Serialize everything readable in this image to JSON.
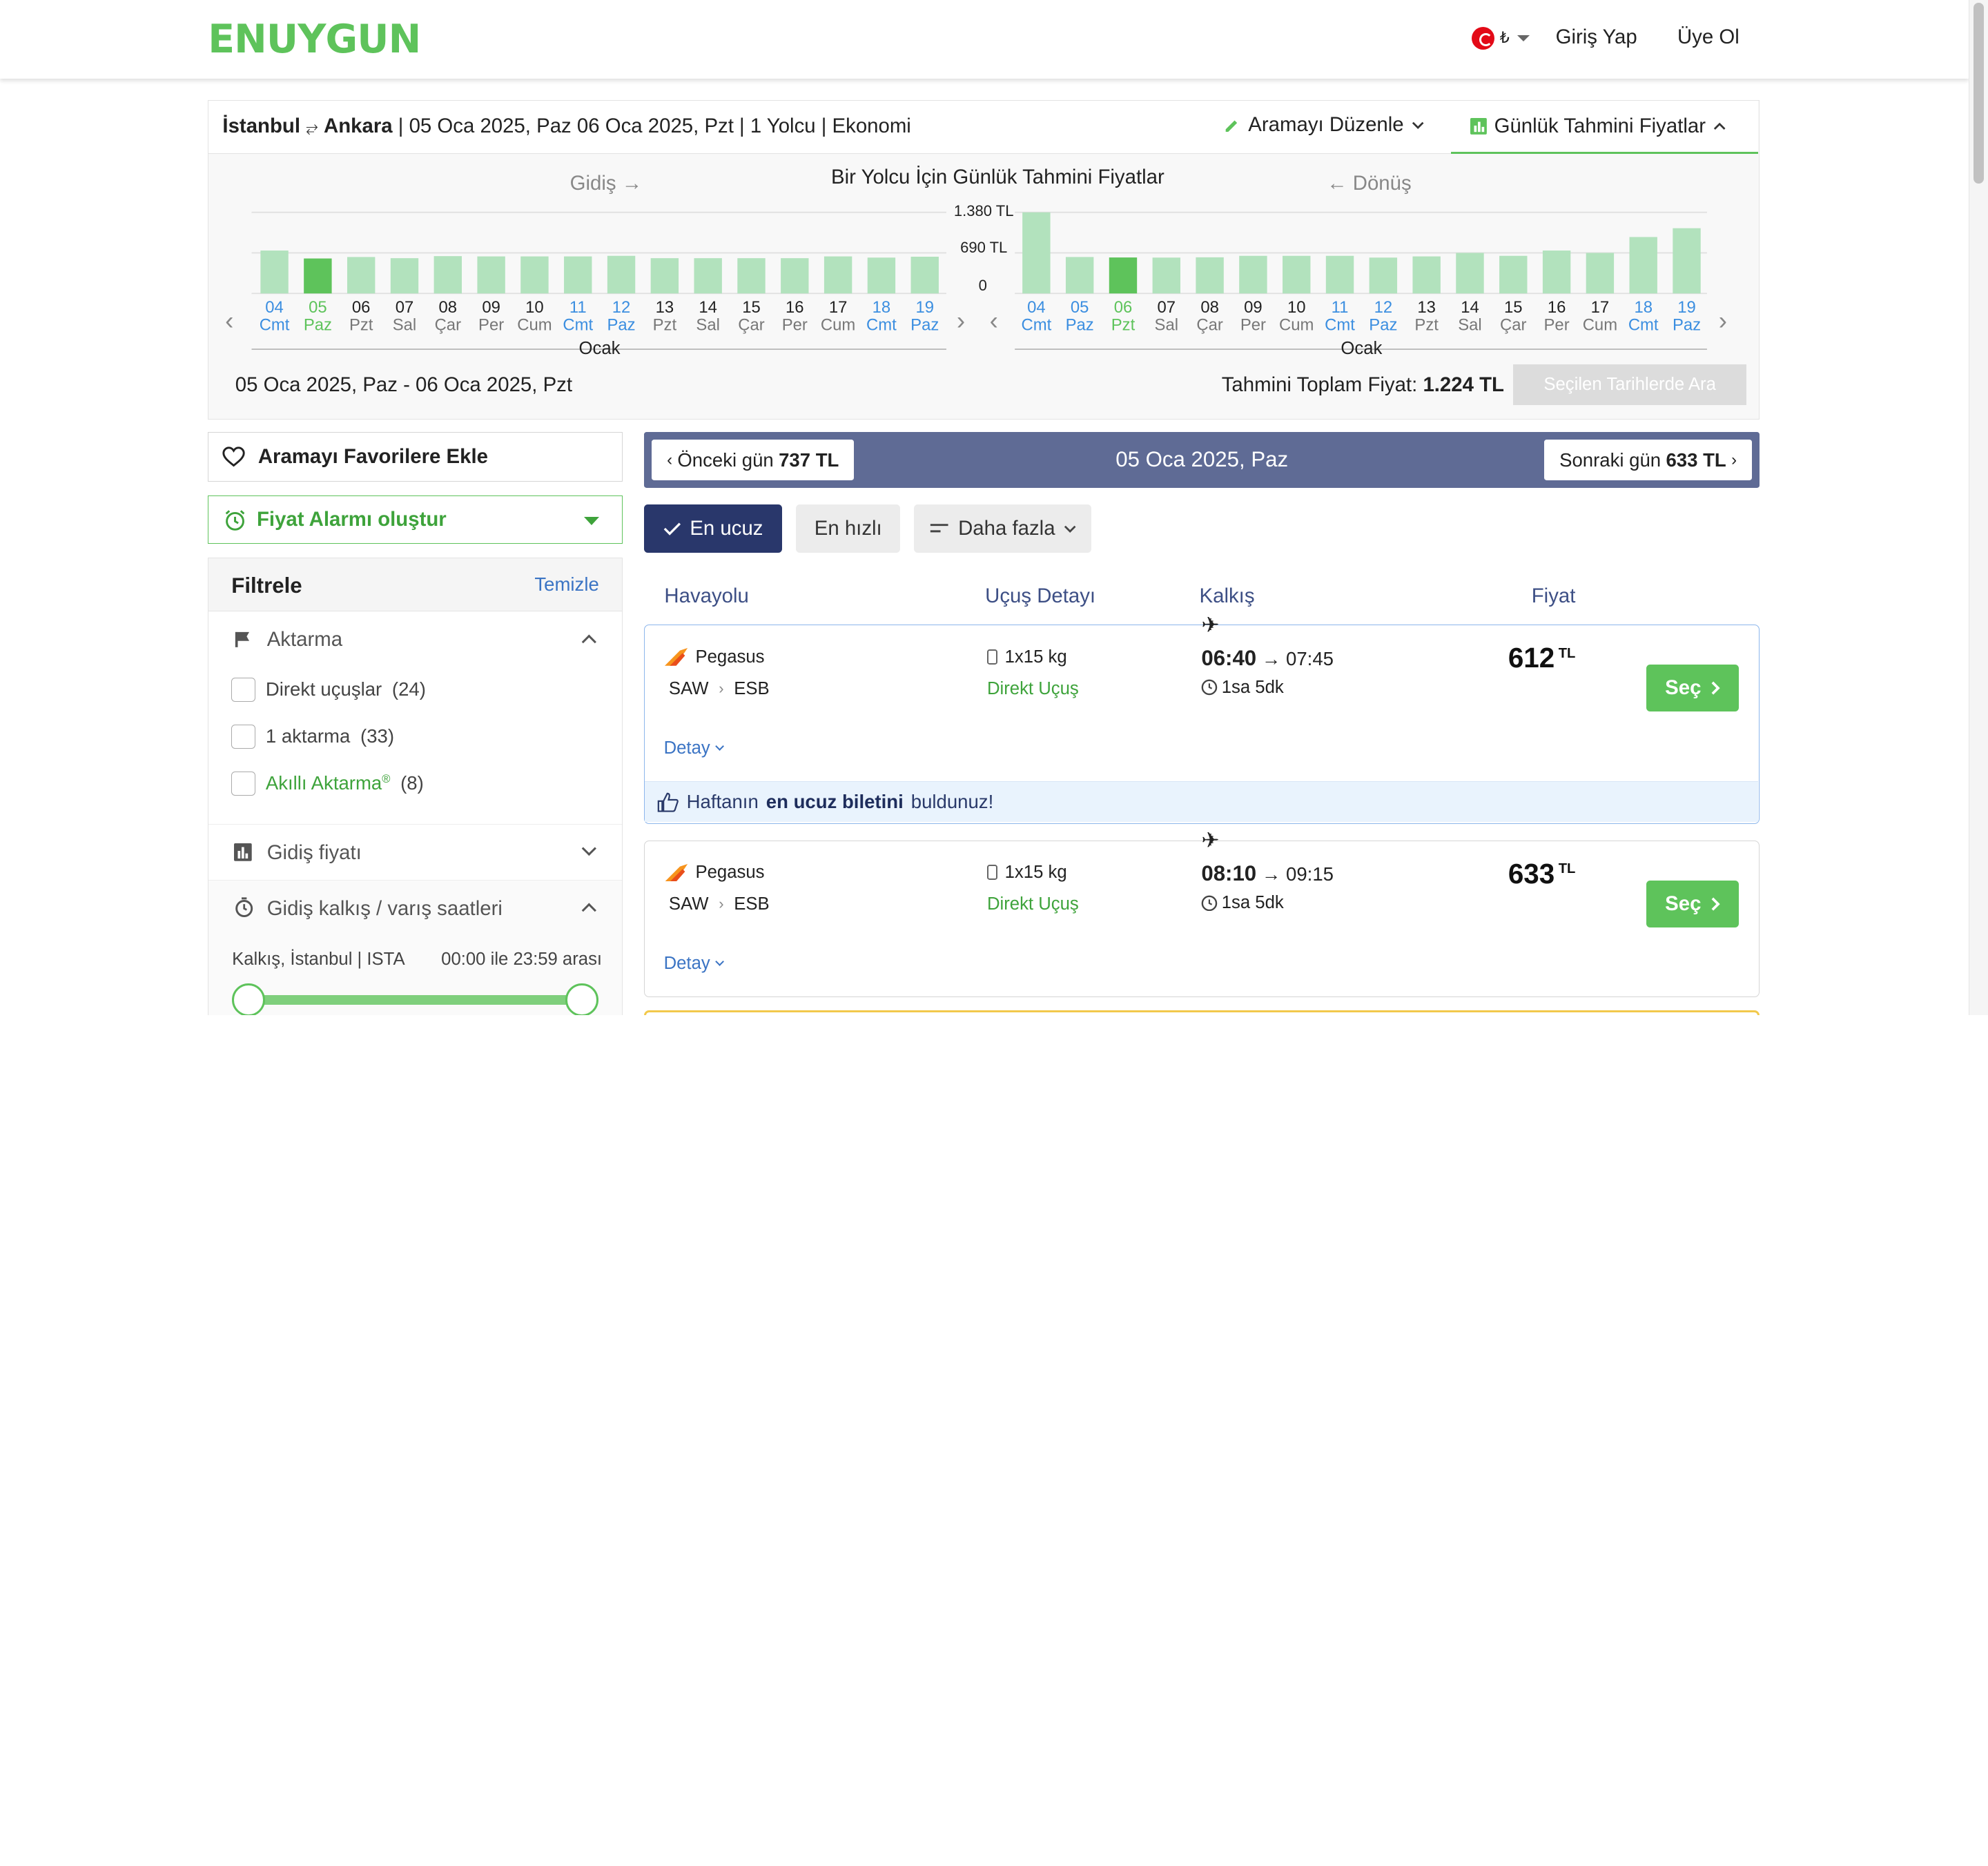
{
  "header": {
    "logo": "ENUYGUN",
    "currency": "₺",
    "login": "Giriş Yap",
    "signup": "Üye Ol"
  },
  "summary": {
    "origin": "İstanbul",
    "destination": "Ankara",
    "details": "| 05 Oca 2025, Paz 06 Oca 2025, Pzt | 1 Yolcu | Ekonomi",
    "edit_search": "Aramayı Düzenle",
    "daily_prices_tab": "Günlük Tahmini Fiyatlar"
  },
  "price_chart": {
    "title": "Bir Yolcu İçin Günlük Tahmini Fiyatlar",
    "outbound_label": "Gidiş",
    "return_label": "Dönüş",
    "y_ticks": [
      "1.380 TL",
      "690 TL",
      "0"
    ],
    "month_label": "Ocak",
    "date_range": "05 Oca 2025, Paz - 06 Oca 2025, Pzt",
    "total_label": "Tahmini Toplam Fiyat:",
    "total_value": "1.224 TL",
    "search_button": "Seçilen Tarihlerde Ara"
  },
  "chart_data": [
    {
      "type": "bar",
      "name": "Gidiş",
      "ylim": [
        0,
        1380
      ],
      "categories": [
        "04 Cmt",
        "05 Paz",
        "06 Pzt",
        "07 Sal",
        "08 Çar",
        "09 Per",
        "10 Cum",
        "11 Cmt",
        "12 Paz",
        "13 Pzt",
        "14 Sal",
        "15 Çar",
        "16 Per",
        "17 Cum",
        "18 Cmt",
        "19 Paz"
      ],
      "days": [
        "04",
        "05",
        "06",
        "07",
        "08",
        "09",
        "10",
        "11",
        "12",
        "13",
        "14",
        "15",
        "16",
        "17",
        "18",
        "19"
      ],
      "weekdays": [
        "Cmt",
        "Paz",
        "Pzt",
        "Sal",
        "Çar",
        "Per",
        "Cum",
        "Cmt",
        "Paz",
        "Pzt",
        "Sal",
        "Çar",
        "Per",
        "Cum",
        "Cmt",
        "Paz"
      ],
      "values": [
        730,
        595,
        620,
        600,
        635,
        630,
        630,
        630,
        640,
        600,
        600,
        600,
        600,
        630,
        610,
        625
      ],
      "selected_index": 1
    },
    {
      "type": "bar",
      "name": "Dönüş",
      "ylim": [
        0,
        1380
      ],
      "categories": [
        "04 Cmt",
        "05 Paz",
        "06 Pzt",
        "07 Sal",
        "08 Çar",
        "09 Per",
        "10 Cum",
        "11 Cmt",
        "12 Paz",
        "13 Pzt",
        "14 Sal",
        "15 Çar",
        "16 Per",
        "17 Cum",
        "18 Cmt",
        "19 Paz"
      ],
      "days": [
        "04",
        "05",
        "06",
        "07",
        "08",
        "09",
        "10",
        "11",
        "12",
        "13",
        "14",
        "15",
        "16",
        "17",
        "18",
        "19"
      ],
      "weekdays": [
        "Cmt",
        "Paz",
        "Pzt",
        "Sal",
        "Çar",
        "Per",
        "Cum",
        "Cmt",
        "Paz",
        "Pzt",
        "Sal",
        "Çar",
        "Per",
        "Cum",
        "Cmt",
        "Paz"
      ],
      "values": [
        1380,
        620,
        612,
        610,
        615,
        640,
        640,
        640,
        610,
        630,
        690,
        640,
        730,
        690,
        960,
        1110
      ],
      "selected_index": 2
    }
  ],
  "left": {
    "favorite_button": "Aramayı Favorilere Ekle",
    "alarm_button": "Fiyat Alarmı oluştur",
    "filters_title": "Filtrele",
    "clear": "Temizle",
    "transfer_title": "Aktarma",
    "options": [
      {
        "label": "Direkt uçuşlar",
        "count": "(24)"
      },
      {
        "label": "1 aktarma",
        "count": "(33)"
      },
      {
        "label": "Akıllı Aktarma",
        "sup": "®",
        "count": "(8)"
      }
    ],
    "outbound_price": "Gidiş fiyatı",
    "time_title": "Gidiş kalkış / varış saatleri",
    "departure_label": "Kalkış, İstanbul | ISTA",
    "time_range": "00:00 ile 23:59 arası"
  },
  "daynav": {
    "prev_label": "Önceki gün",
    "prev_price": "737 TL",
    "current": "05 Oca 2025, Paz",
    "next_label": "Sonraki gün",
    "next_price": "633 TL"
  },
  "sort": {
    "cheapest": "En ucuz",
    "fastest": "En hızlı",
    "more": "Daha fazla"
  },
  "columns": {
    "airline": "Havayolu",
    "detail": "Uçuş Detayı",
    "departure": "Kalkış",
    "price": "Fiyat"
  },
  "flights": [
    {
      "airline": "Pegasus",
      "from": "SAW",
      "to": "ESB",
      "baggage": "1x15 kg",
      "type": "Direkt Uçuş",
      "dep": "06:40",
      "arr": "→ 07:45",
      "duration": "1sa 5dk",
      "price": "612",
      "currency": "TL",
      "select": "Seç",
      "detail": "Detay",
      "badge_pre": "Haftanın",
      "badge_bold": "en ucuz biletini",
      "badge_post": "buldunuz!"
    },
    {
      "airline": "Pegasus",
      "from": "SAW",
      "to": "ESB",
      "baggage": "1x15 kg",
      "type": "Direkt Uçuş",
      "dep": "08:10",
      "arr": "→ 09:15",
      "duration": "1sa 5dk",
      "price": "633",
      "currency": "TL",
      "select": "Seç",
      "detail": "Detay"
    }
  ],
  "colors": {
    "brand_green": "#5ec35b",
    "bar": "#b2e2bd",
    "bar_selected": "#5ec35b",
    "weekend_blue": "#3b8ee0",
    "nav_bg": "#5f6b95",
    "sort_active": "#29376b"
  }
}
